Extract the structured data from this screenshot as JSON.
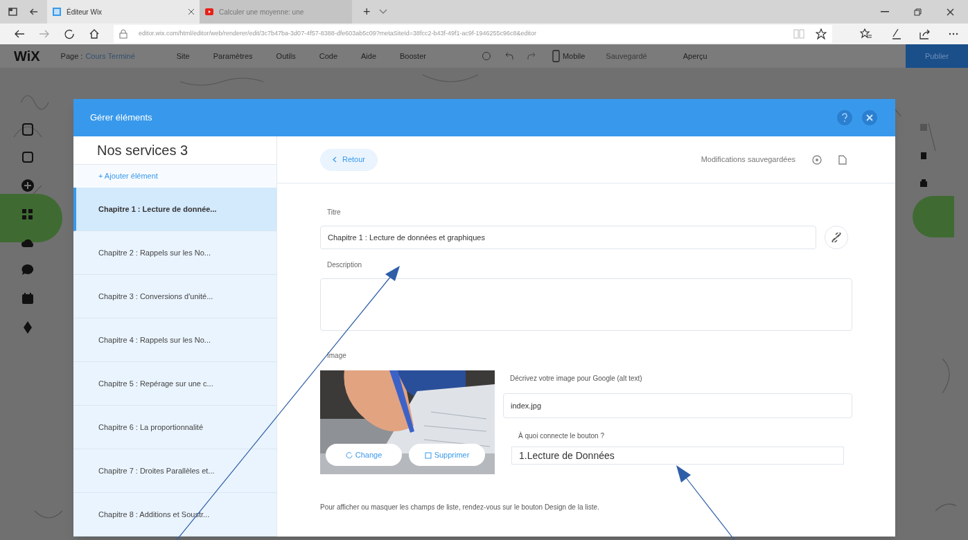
{
  "browser": {
    "tabs": [
      {
        "title": "Éditeur Wix",
        "selected": true
      },
      {
        "title": "Calculer une moyenne: une",
        "selected": false
      }
    ],
    "new_tab": "+",
    "url": "editor.wix.com/html/editor/web/renderer/edit/3c7b47ba-3d07-4f57-8388-dfe603ab5c09?metaSiteId=38fcc2-b43f-49f1-ac9f-1946255c96c8&editor"
  },
  "editor_toolbar": {
    "logo": "WiX",
    "page_label": "Page :",
    "page_name": "Cours Terminé",
    "menu": [
      "Site",
      "Paramètres",
      "Outils",
      "Code",
      "Aide",
      "Booster"
    ],
    "mobile": "Mobile",
    "saved": "Sauvegardé",
    "preview": "Aperçu",
    "publish": "Publier"
  },
  "dialog": {
    "title": "Gérer éléments",
    "list_title": "Nos services 3",
    "add_item": "+ Ajouter élément",
    "items": [
      {
        "label": "Chapitre 1 : Lecture de donnée...",
        "selected": true
      },
      {
        "label": "Chapitre 2 : Rappels sur les No...",
        "selected": false
      },
      {
        "label": "Chapitre 3 : Conversions d'unité...",
        "selected": false
      },
      {
        "label": "Chapitre 4 : Rappels sur les No...",
        "selected": false
      },
      {
        "label": "Chapitre 5 : Repérage sur une c...",
        "selected": false
      },
      {
        "label": "Chapitre 6 : La proportionnalité",
        "selected": false
      },
      {
        "label": "Chapitre 7 : Droites Parallèles et...",
        "selected": false
      },
      {
        "label": "Chapitre 8 : Additions et Soustr...",
        "selected": false
      }
    ],
    "back": "Retour",
    "status": "Modifications sauvegardées",
    "title_label": "Titre",
    "title_value": "Chapitre 1 : Lecture de données et graphiques",
    "description_label": "Description",
    "image_label": "Image",
    "change": "Change",
    "delete": "Supprimer",
    "alt_label": "Décrivez votre image pour Google (alt text)",
    "alt_value": "index.jpg",
    "button_label": "À quoi connecte le bouton ?",
    "button_value": "1.Lecture de Données",
    "footer_note": "Pour afficher ou masquer les champs de liste, rendez-vous sur le bouton Design de la liste."
  }
}
